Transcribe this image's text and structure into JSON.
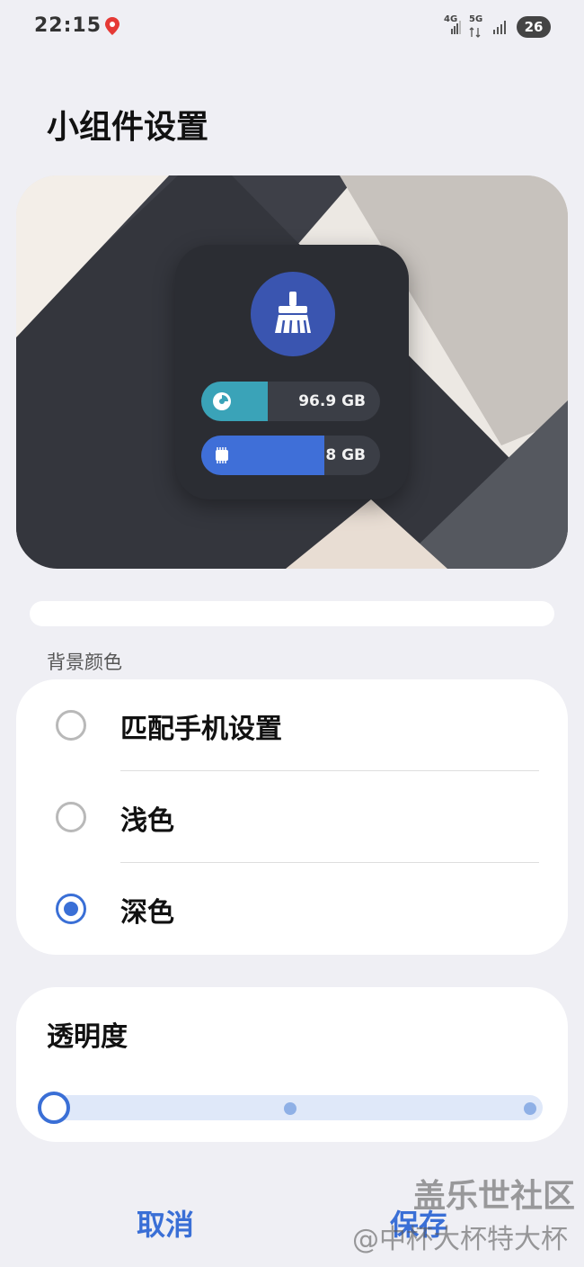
{
  "status_bar": {
    "time": "22:15",
    "network_1": "4G",
    "network_2": "5G",
    "battery": "26",
    "icons": [
      "map-pin-icon",
      "signal-icon",
      "signal-icon",
      "battery-icon"
    ]
  },
  "page": {
    "title": "小组件设置"
  },
  "preview_widget": {
    "icon": "broom-clean-icon",
    "storage": {
      "icon": "pie-chart-icon",
      "value": "96.9 GB",
      "used_fraction": 0.37
    },
    "memory": {
      "icon": "chip-icon",
      "value": "8 GB",
      "used_fraction": 0.69
    },
    "colors": {
      "storage_fill": "#3aa3b8",
      "memory_fill": "#3f6fd8",
      "clean_button": "#3a55b0",
      "widget_bg": "#2b2d33"
    }
  },
  "background_color": {
    "section_label": "背景颜色",
    "options": [
      {
        "label": "匹配手机设置",
        "selected": false
      },
      {
        "label": "浅色",
        "selected": false
      },
      {
        "label": "深色",
        "selected": true
      }
    ]
  },
  "transparency": {
    "title": "透明度",
    "level": 0,
    "stops": 3
  },
  "actions": {
    "cancel": "取消",
    "save": "保存"
  },
  "watermark": {
    "line1": "盖乐世社区",
    "line2": "@中杯大杯特大杯"
  },
  "accent_color": "#3a6fd6"
}
